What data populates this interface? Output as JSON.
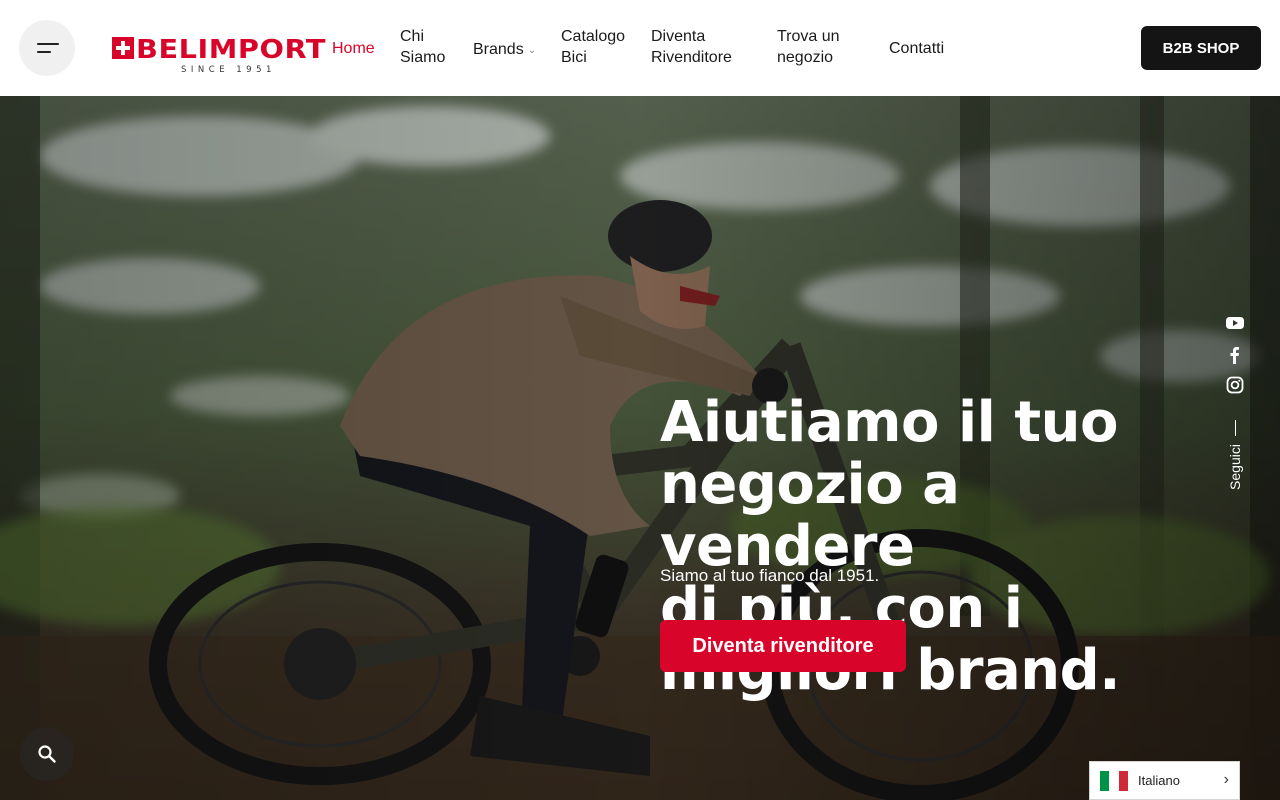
{
  "header": {
    "menu_icon": "hamburger-menu-icon",
    "logo": {
      "brand": "BELIMPORT",
      "tagline": "SINCE 1951",
      "color": "#d90429"
    },
    "nav": {
      "home": "Home",
      "chi_siamo": "Chi Siamo",
      "brands": "Brands",
      "catalogo_bici": "Catalogo Bici",
      "diventa_rivenditore": "Diventa Rivenditore",
      "trova_negozio": "Trova un negozio",
      "contatti": "Contatti"
    },
    "active_nav": "home",
    "b2b_button": "B2B SHOP"
  },
  "hero": {
    "title": "Aiutiamo il tuo\nnegozio a vendere\ndi più, con i\nmigliori brand.",
    "subtitle": "Siamo al tuo fianco dal 1951.",
    "cta": "Diventa rivenditore"
  },
  "social": {
    "label": "Seguici",
    "icons": [
      "youtube-icon",
      "facebook-icon",
      "instagram-icon"
    ]
  },
  "search": {
    "icon": "search-icon"
  },
  "language": {
    "label": "Italiano",
    "flag": "italy-flag-icon"
  },
  "colors": {
    "accent": "#d90429",
    "dark": "#141414"
  }
}
